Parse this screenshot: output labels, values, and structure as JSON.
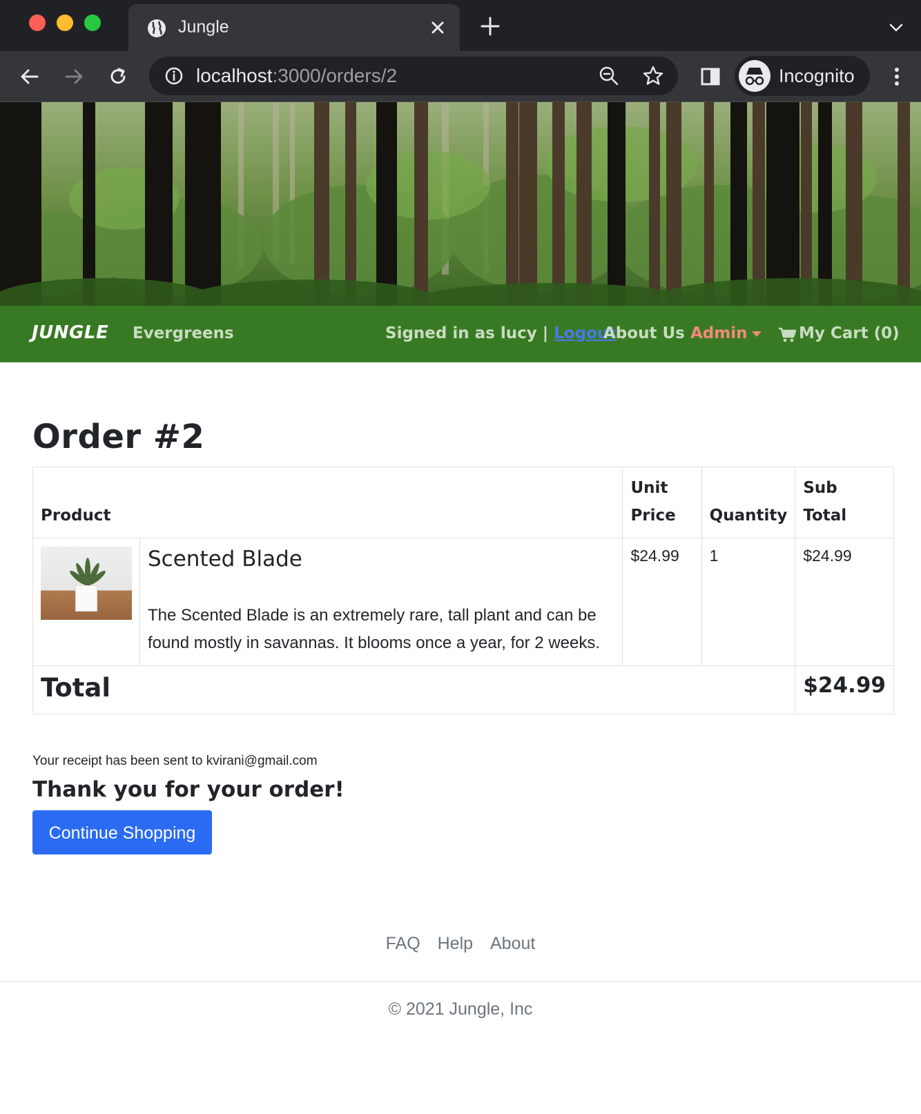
{
  "browser": {
    "tab_title": "Jungle",
    "url_host": "localhost",
    "url_rest": ":3000/orders/2",
    "profile_label": "Incognito"
  },
  "nav": {
    "brand": "JUNGLE",
    "category": "Evergreens",
    "signed_in": "Signed in as lucy |",
    "logout": "Logout",
    "about": "About Us",
    "admin": "Admin",
    "cart": "My Cart (0)"
  },
  "order": {
    "title": "Order #2",
    "headers": {
      "product": "Product",
      "unit_price": "Unit Price",
      "quantity": "Quantity",
      "sub_total": "Sub Total"
    },
    "item": {
      "name": "Scented Blade",
      "description": "The Scented Blade is an extremely rare, tall plant and can be found mostly in savannas. It blooms once a year, for 2 weeks.",
      "unit_price": "$24.99",
      "quantity": "1",
      "sub_total": "$24.99"
    },
    "total_label": "Total",
    "total_amount": "$24.99"
  },
  "receipt": "Your receipt has been sent to kvirani@gmail.com",
  "thanks": "Thank you for your order!",
  "continue_button": "Continue Shopping",
  "footer": {
    "links": [
      "FAQ",
      "Help",
      "About"
    ],
    "copyright": "© 2021 Jungle, Inc"
  },
  "colors": {
    "navbar": "#387a23",
    "primary_button": "#2a6bf2",
    "admin_link": "#f08a7a",
    "logout_link": "#4a78e8"
  },
  "icons": [
    "globe-icon",
    "close-icon",
    "plus-icon",
    "chevron-down-icon",
    "back-arrow-icon",
    "forward-arrow-icon",
    "reload-icon",
    "info-icon",
    "zoom-icon",
    "star-icon",
    "sidebar-icon",
    "incognito-icon",
    "kebab-menu-icon",
    "cart-icon",
    "caret-down-icon"
  ]
}
